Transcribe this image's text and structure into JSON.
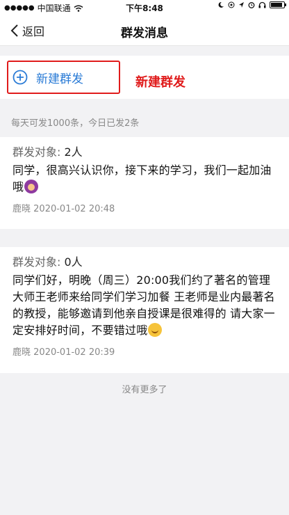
{
  "status_bar": {
    "carrier": "中国联通",
    "time": "下午8:48"
  },
  "nav": {
    "back_label": "返回",
    "title": "群发消息"
  },
  "new_group": {
    "button_label": "新建群发",
    "annotation": "新建群发"
  },
  "quota_text": "每天可发1000条，今日已发2条",
  "messages": [
    {
      "target_label": "群发对象:",
      "target_count": "2人",
      "text": "同学，很高兴认识你，接下来的学习，我们一起加油哦",
      "emoji": "woman-gesturing-emoji",
      "author": "鹿晓",
      "time": "2020-01-02 20:48"
    },
    {
      "target_label": "群发对象:",
      "target_count": "0人",
      "text": "同学们好，明晚（周三）20:00我们约了著名的管理大师王老师来给同学们学习加餐 王老师是业内最著名的教授，能够邀请到他亲自授课是很难得的 请大家一定安排好时间，不要错过哦",
      "emoji": "smiling-face-emoji",
      "author": "鹿晓",
      "time": "2020-01-02 20:39"
    }
  ],
  "footer_text": "没有更多了",
  "colors": {
    "accent": "#2a7bd6",
    "annotation_red": "#e01b1b",
    "background": "#f2f2f4"
  }
}
